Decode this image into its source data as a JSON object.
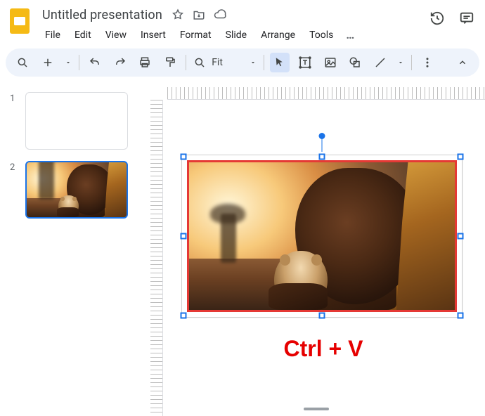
{
  "app": {
    "doc_title": "Untitled presentation"
  },
  "menubar": {
    "items": [
      "File",
      "Edit",
      "View",
      "Insert",
      "Format",
      "Slide",
      "Arrange",
      "Tools"
    ],
    "overflow": "…"
  },
  "toolbar": {
    "zoom_label": "Fit"
  },
  "thumbnails": {
    "slides": [
      {
        "number": "1",
        "selected": false
      },
      {
        "number": "2",
        "selected": true
      }
    ]
  },
  "annotation": {
    "text": "Ctrl + V"
  },
  "colors": {
    "selection_border": "#e53935",
    "annotation_text": "#e60000",
    "accent": "#1a73e8",
    "toolbar_bg": "#eef3fb"
  },
  "icons": {
    "slides_logo": "slides-logo",
    "star": "star-outline-icon",
    "move": "move-to-folder-icon",
    "cloud": "cloud-done-icon",
    "history": "history-icon",
    "comments": "comments-icon",
    "search": "search-icon",
    "new_slide": "new-slide-icon",
    "undo": "undo-icon",
    "redo": "redo-icon",
    "print": "print-icon",
    "paint": "paint-format-icon",
    "zoom": "zoom-icon",
    "select": "select-tool-icon",
    "textbox": "text-box-icon",
    "image": "insert-image-icon",
    "shape": "shape-icon",
    "line": "line-icon",
    "more": "more-vert-icon",
    "collapse": "collapse-icon"
  }
}
